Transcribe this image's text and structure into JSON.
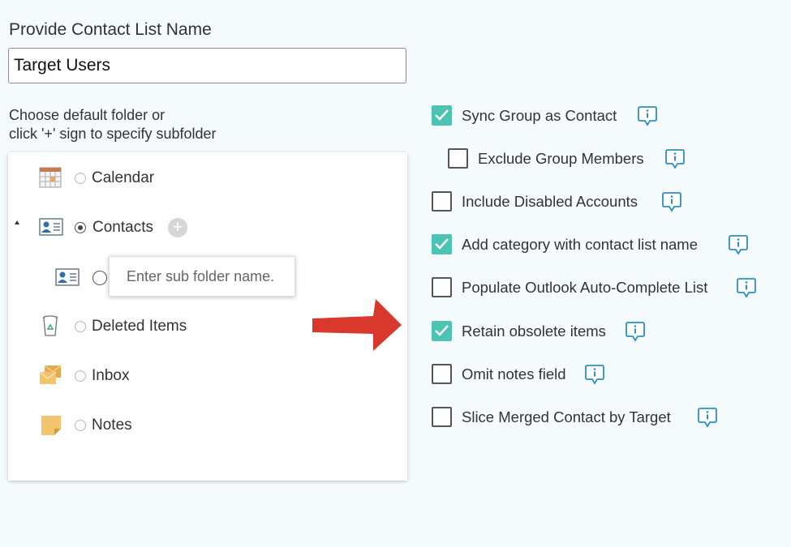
{
  "form": {
    "title": "Provide Contact List Name",
    "contact_list_name": "Target Users",
    "instruction_line1": "Choose default folder or",
    "instruction_line2": "click '+' sign to specify subfolder"
  },
  "folders": {
    "items": [
      {
        "label": "Calendar",
        "icon": "calendar-icon",
        "selected": false
      },
      {
        "label": "Contacts",
        "icon": "contact-card-icon",
        "selected": true
      },
      {
        "label": "Deleted Items",
        "icon": "trash-icon",
        "selected": false
      },
      {
        "label": "Inbox",
        "icon": "inbox-envelope-icon",
        "selected": false
      },
      {
        "label": "Notes",
        "icon": "note-icon",
        "selected": false
      }
    ],
    "add_button_symbol": "+",
    "subfolder_placeholder": "Enter sub folder name."
  },
  "options": {
    "items": [
      {
        "label": "Sync Group as Contact",
        "checked": true
      },
      {
        "label": "Exclude Group Members",
        "checked": false
      },
      {
        "label": "Include Disabled Accounts",
        "checked": false
      },
      {
        "label": "Add category with contact list name",
        "checked": true
      },
      {
        "label": "Populate Outlook Auto-Complete List",
        "checked": false
      },
      {
        "label": "Retain obsolete items",
        "checked": true
      },
      {
        "label": "Omit notes field",
        "checked": false
      },
      {
        "label": "Slice Merged Contact by Target",
        "checked": false
      }
    ]
  },
  "colors": {
    "check_accent": "#4cc3b3",
    "info_icon": "#2b8fc4",
    "arrow": "#d9382c",
    "background": "#f5fbfd"
  }
}
